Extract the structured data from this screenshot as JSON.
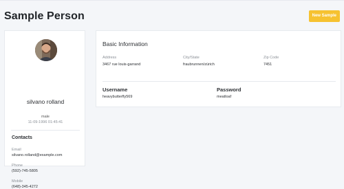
{
  "header": {
    "title": "Sample Person",
    "new_sample_label": "New Sample"
  },
  "profile": {
    "name": "silvano rolland",
    "gender": "male",
    "dob": "11-09-1996 01:45:41",
    "contacts_title": "Contacts",
    "contacts": [
      {
        "label": "Email",
        "value": "silvano.rolland@example.com"
      },
      {
        "label": "Phone",
        "value": "(592)-745-5805"
      },
      {
        "label": "Mobile",
        "value": "(648)-345-4272"
      }
    ]
  },
  "basic_info": {
    "title": "Basic Information",
    "fields": [
      {
        "label": "Address",
        "value": "3467 rue louis-garrand"
      },
      {
        "label": "City/State",
        "value": "fraubrunnen/zürich"
      },
      {
        "label": "Zip Code",
        "value": "7451"
      }
    ],
    "username_label": "Username",
    "username_value": "heavybutterfly569",
    "password_label": "Password",
    "password_value": "meatloaf"
  },
  "colors": {
    "accent": "#f6c231",
    "background": "#f4f6f9"
  }
}
